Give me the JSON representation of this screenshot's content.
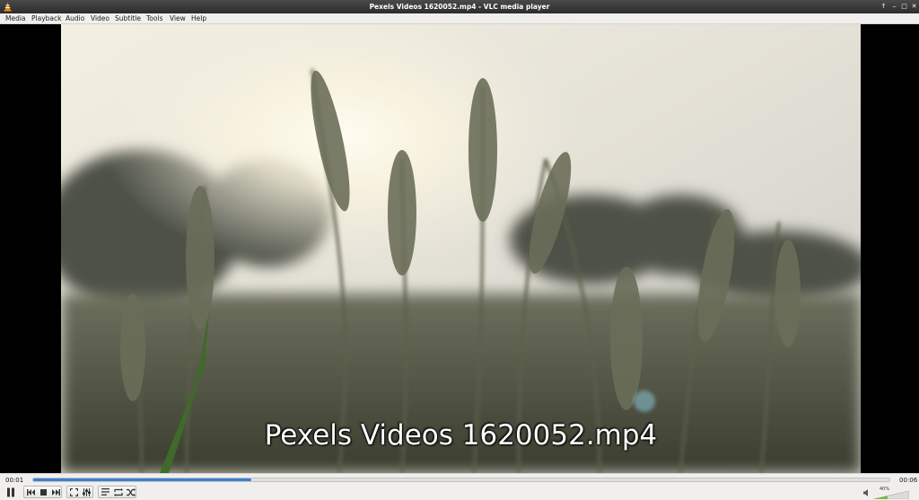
{
  "window": {
    "title": "Pexels Videos 1620052.mp4 - VLC media player"
  },
  "menu": {
    "items": [
      "Media",
      "Playback",
      "Audio",
      "Video",
      "Subtitle",
      "Tools",
      "View",
      "Help"
    ]
  },
  "video": {
    "subtitle": "Pexels Videos 1620052.mp4"
  },
  "controls": {
    "elapsed": "00:01",
    "total": "00:06",
    "progress_fraction": 0.255,
    "volume_label": "40%",
    "volume_fraction": 0.4,
    "buttons": {
      "play_pause": "pause-icon",
      "previous": "skip-previous-icon",
      "stop": "stop-icon",
      "next": "skip-next-icon",
      "fullscreen": "fullscreen-icon",
      "extended": "equalizer-icon",
      "playlist": "playlist-icon",
      "loop": "loop-icon",
      "random": "shuffle-icon"
    }
  },
  "colors": {
    "accent": "#3a7fd4",
    "titlebar": "#333333",
    "toolbar": "#f0efee"
  }
}
